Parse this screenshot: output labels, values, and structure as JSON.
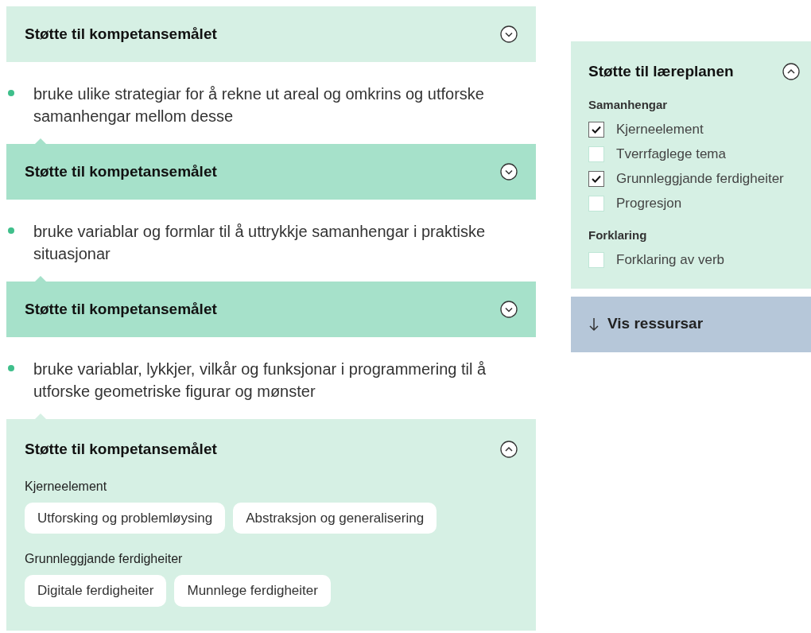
{
  "blocks": [
    {
      "kind": "support",
      "title": "Støtte til kompetansemålet",
      "expanded": false,
      "highlighted": false,
      "notch": false
    },
    {
      "kind": "goal",
      "text": "bruke ulike strategiar for å rekne ut areal og omkrins og utforske samanhengar mellom desse"
    },
    {
      "kind": "support",
      "title": "Støtte til kompetansemålet",
      "expanded": false,
      "highlighted": true,
      "notch": true
    },
    {
      "kind": "goal",
      "text": "bruke variablar og formlar til å uttrykkje samanhengar i praktiske situasjonar"
    },
    {
      "kind": "support",
      "title": "Støtte til kompetansemålet",
      "expanded": false,
      "highlighted": true,
      "notch": true
    },
    {
      "kind": "goal",
      "text": "bruke variablar, lykkjer, vilkår og funksjonar i programmering til å utforske geometriske figurar og mønster"
    },
    {
      "kind": "support",
      "title": "Støtte til kompetansemålet",
      "expanded": true,
      "highlighted": false,
      "notch": true,
      "groups": [
        {
          "heading": "Kjerneelement",
          "tags": [
            "Utforsking og problemløysing",
            "Abstraksjon og generalisering"
          ]
        },
        {
          "heading": "Grunnleggjande ferdigheiter",
          "tags": [
            "Digitale ferdigheiter",
            "Munnlege ferdigheiter"
          ]
        }
      ]
    }
  ],
  "curriculum": {
    "title": "Støtte til læreplanen",
    "expanded": true,
    "groups": [
      {
        "heading": "Samanhengar",
        "options": [
          {
            "label": "Kjerneelement",
            "checked": true
          },
          {
            "label": "Tverrfaglege tema",
            "checked": false
          },
          {
            "label": "Grunnleggjande ferdigheiter",
            "checked": true
          },
          {
            "label": "Progresjon",
            "checked": false
          }
        ]
      },
      {
        "heading": "Forklaring",
        "options": [
          {
            "label": "Forklaring av verb",
            "checked": false
          }
        ]
      }
    ]
  },
  "show_button": "Vis ressursar"
}
